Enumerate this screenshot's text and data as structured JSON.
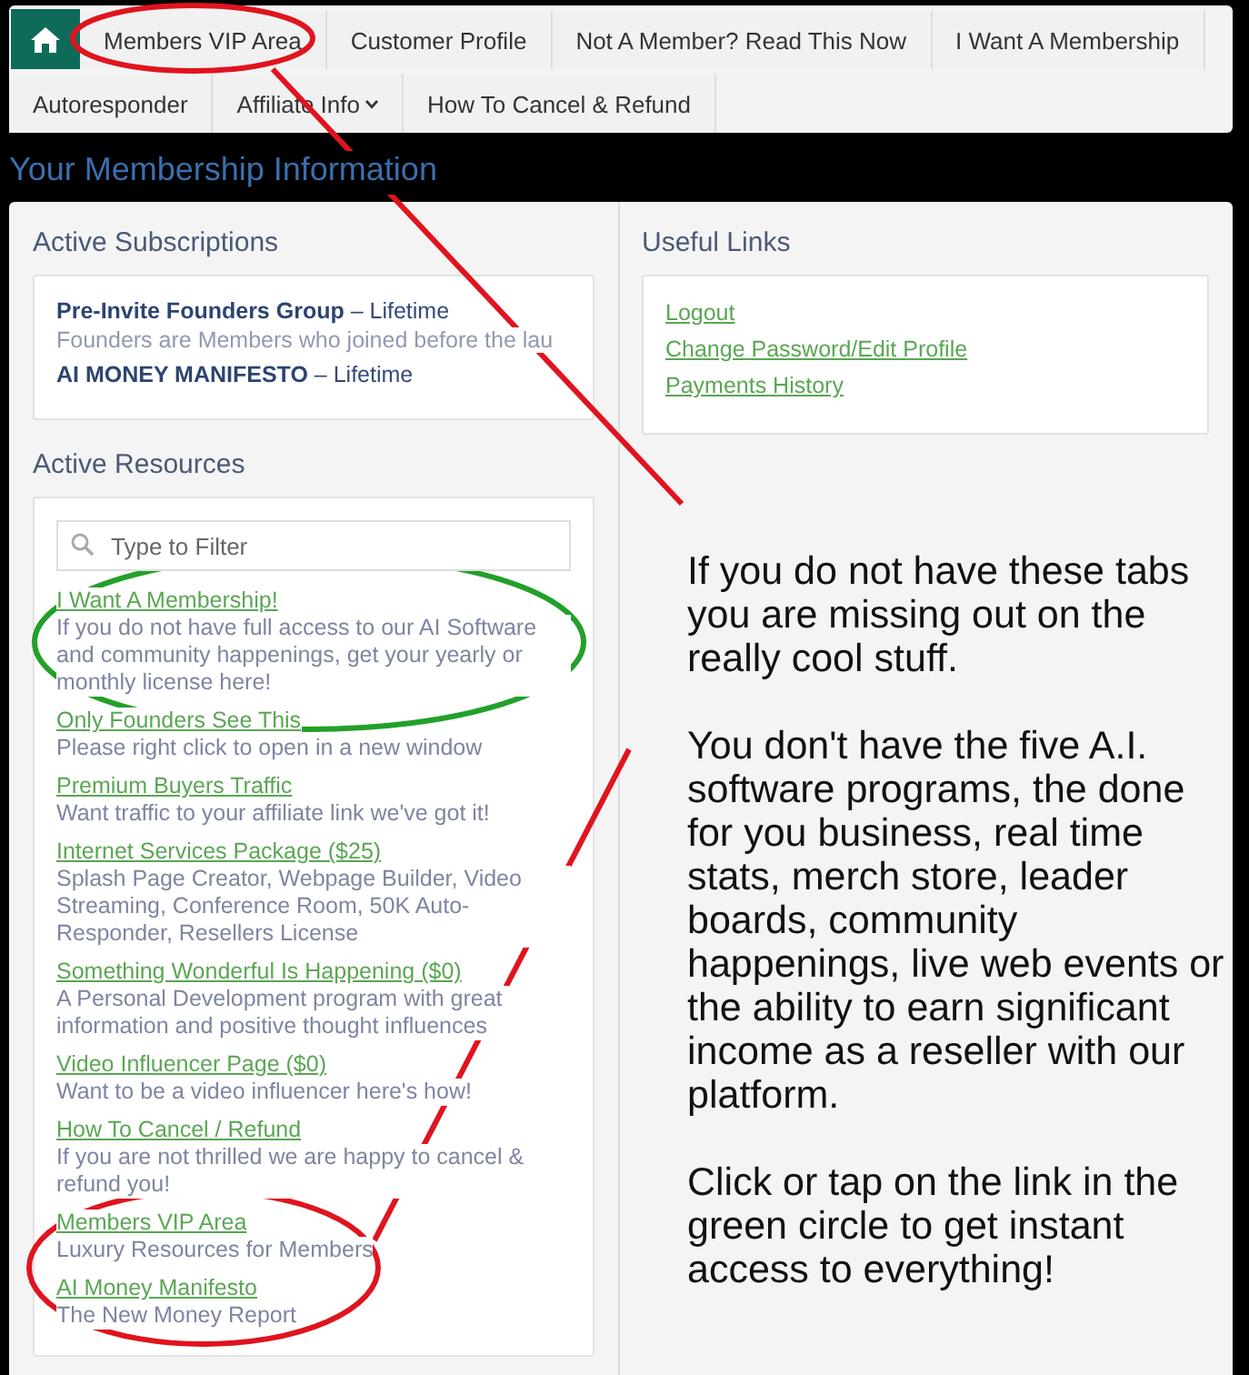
{
  "nav": {
    "tabs": [
      {
        "label": "Members VIP Area",
        "dropdown": false
      },
      {
        "label": "Customer Profile",
        "dropdown": false
      },
      {
        "label": "Not A Member? Read This Now",
        "dropdown": false
      },
      {
        "label": "I Want A Membership",
        "dropdown": false
      },
      {
        "label": "Autoresponder",
        "dropdown": false
      },
      {
        "label": "Affiliate Info",
        "dropdown": true
      },
      {
        "label": "How To Cancel & Refund",
        "dropdown": false
      }
    ]
  },
  "page_title": "Your Membership Information",
  "subscriptions": {
    "title": "Active Subscriptions",
    "items": [
      {
        "name": "Pre-Invite Founders Group",
        "term": "– Lifetime",
        "note": "Founders are Members who joined before the lau"
      },
      {
        "name": "AI MONEY MANIFESTO",
        "term": "– Lifetime"
      }
    ]
  },
  "resources": {
    "title": "Active Resources",
    "search": {
      "placeholder": "Type to Filter"
    },
    "items": [
      {
        "title": "I Want A Membership!",
        "description": "If you do not have full access to our AI Software and community happenings, get your yearly or monthly license here!"
      },
      {
        "title": "Only Founders See This",
        "description": "Please right click to open in a new window"
      },
      {
        "title": "Premium Buyers Traffic",
        "description": "Want traffic to your affiliate link we've got it!"
      },
      {
        "title": "Internet Services Package ($25)",
        "description": "Splash Page Creator, Webpage Builder, Video Streaming, Conference Room, 50K Auto-Responder, Resellers License"
      },
      {
        "title": "Something Wonderful Is Happening ($0)",
        "description": "A Personal Development program with great information and positive thought influences"
      },
      {
        "title": "Video Influencer Page ($0)",
        "description": "Want to be a video influencer here's how!"
      },
      {
        "title": "How To Cancel / Refund",
        "description": "If you are not thrilled we are happy to cancel & refund you!"
      },
      {
        "title": "Members VIP Area",
        "description": "Luxury Resources for Members"
      },
      {
        "title": "AI Money Manifesto",
        "description": "The New Money Report"
      }
    ]
  },
  "useful_links": {
    "title": "Useful Links",
    "links": [
      "Logout",
      "Change Password/Edit Profile",
      "Payments History"
    ]
  },
  "annotation": {
    "paragraphs": [
      "If you do not have these tabs you are missing out on the really cool stuff.",
      "You don't have the five A.I. software programs, the done for you business, real time stats, merch store, leader boards, community happenings, live web events or the ability to earn significant income as a reseller with our platform.",
      "Click or tap on the link in the green circle to get instant access to everything!"
    ]
  }
}
